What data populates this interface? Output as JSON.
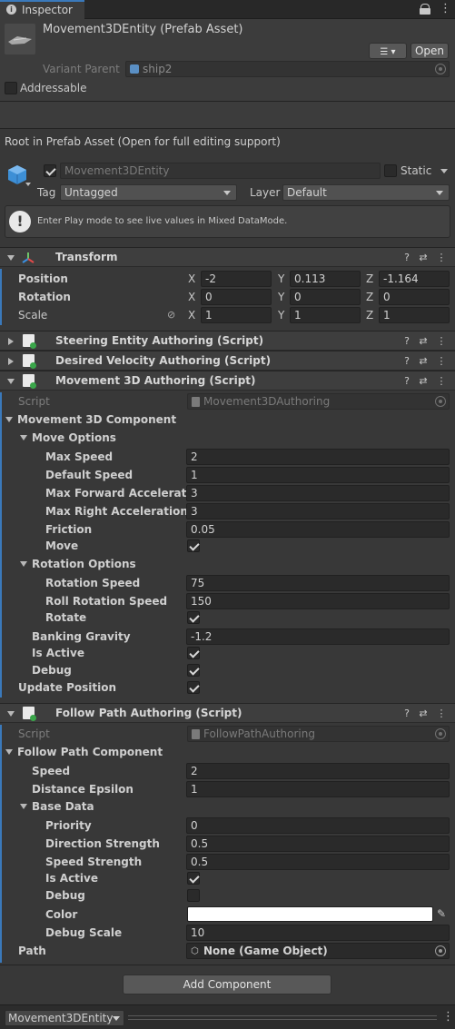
{
  "tab": {
    "title": "Inspector"
  },
  "asset": {
    "title": "Movement3DEntity (Prefab Asset)",
    "open_button": "Open",
    "variant_parent_label": "Variant Parent",
    "variant_parent_value": "ship2",
    "addressable_label": "Addressable",
    "root_notice": "Root in Prefab Asset (Open for full editing support)"
  },
  "gameobject": {
    "name": "Movement3DEntity",
    "static_label": "Static",
    "tag_label": "Tag",
    "tag_value": "Untagged",
    "layer_label": "Layer",
    "layer_value": "Default",
    "info_message": "Enter Play mode to see live values in Mixed DataMode."
  },
  "transform": {
    "title": "Transform",
    "position_label": "Position",
    "rotation_label": "Rotation",
    "scale_label": "Scale",
    "x": "X",
    "y": "Y",
    "z": "Z",
    "position": [
      "-2",
      "0.113",
      "-1.164"
    ],
    "rotation": [
      "0",
      "0",
      "0"
    ],
    "scale": [
      "1",
      "1",
      "1"
    ]
  },
  "components": {
    "steering": "Steering Entity Authoring (Script)",
    "desired_velocity": "Desired Velocity Authoring (Script)",
    "movement": "Movement 3D Authoring (Script)",
    "follow": "Follow Path Authoring (Script)"
  },
  "movement": {
    "script_label": "Script",
    "script_value": "Movement3DAuthoring",
    "component_label": "Movement 3D Component",
    "move_options": "Move Options",
    "max_speed_label": "Max Speed",
    "max_speed": "2",
    "default_speed_label": "Default Speed",
    "default_speed": "1",
    "max_fwd_label": "Max Forward Acceleration",
    "max_fwd": "3",
    "max_right_label": "Max Right Acceleration",
    "max_right": "3",
    "friction_label": "Friction",
    "friction": "0.05",
    "move_label": "Move",
    "move": true,
    "rotation_options": "Rotation Options",
    "rot_speed_label": "Rotation Speed",
    "rot_speed": "75",
    "roll_speed_label": "Roll Rotation Speed",
    "roll_speed": "150",
    "rotate_label": "Rotate",
    "rotate": true,
    "banking_label": "Banking Gravity",
    "banking": "-1.2",
    "is_active_label": "Is Active",
    "is_active": true,
    "debug_label": "Debug",
    "debug": true,
    "update_position_label": "Update Position",
    "update_position": true
  },
  "follow": {
    "script_label": "Script",
    "script_value": "FollowPathAuthoring",
    "component_label": "Follow Path Component",
    "speed_label": "Speed",
    "speed": "2",
    "epsilon_label": "Distance Epsilon",
    "epsilon": "1",
    "base_data": "Base Data",
    "priority_label": "Priority",
    "priority": "0",
    "direction_label": "Direction Strength",
    "direction": "0.5",
    "speed_strength_label": "Speed Strength",
    "speed_strength": "0.5",
    "is_active_label": "Is Active",
    "is_active": true,
    "debug_label": "Debug",
    "debug": false,
    "color_label": "Color",
    "color": "#ffffff",
    "debug_scale_label": "Debug Scale",
    "debug_scale": "10",
    "path_label": "Path",
    "path_value": "None (Game Object)"
  },
  "footer": {
    "add_component": "Add Component",
    "entity_dropdown": "Movement3DEntity"
  },
  "colors": {
    "accent": "#3a79bb",
    "script_green": "#3aa64a"
  }
}
